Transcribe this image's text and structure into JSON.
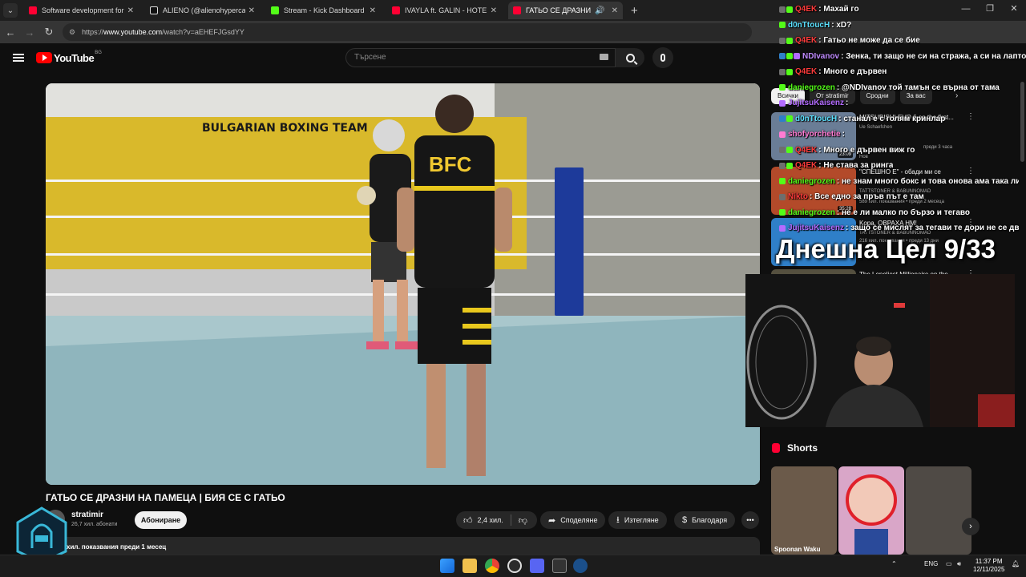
{
  "browser": {
    "tabs": [
      {
        "title": "Software development for the",
        "favicon_color": "#ff0033",
        "active": false
      },
      {
        "title": "ALIENO (@alienohypercars) | TikTok",
        "favicon_color": "#ffffff",
        "active": false
      },
      {
        "title": "Stream - Kick Dashboard",
        "favicon_color": "#53fc18",
        "active": false
      },
      {
        "title": "IVAYLA ft. GALIN - HOTEL | ИВА",
        "favicon_color": "#ff0033",
        "active": false
      },
      {
        "title": "ГАТЬО СЕ ДРАЗНИ НА ПАМ",
        "favicon_color": "#ff0033",
        "active": true
      }
    ],
    "url_prefix": "https://",
    "url_host": "www.youtube.com",
    "url_path": "/watch?v=aEHEFJGsdYY"
  },
  "youtube": {
    "logo_text": "YouTube",
    "region": "BG",
    "search_placeholder": "Търсене",
    "video_title": "ГАТЬО СЕ ДРАЗНИ НА ПАМЕЦА | БИЯ СЕ С ГАТЬО",
    "channel_name": "stratimir",
    "subscribers": "26,7 хил. абонати",
    "subscribe_label": "Абониране",
    "likes": "2,4 хил.",
    "share_label": "Споделяне",
    "download_label": "Изтегляне",
    "thanks_label": "Благодаря",
    "desc_meta": "хил. показвания  преди 1 месец",
    "wall_text": "BULGARIAN BOXING TEAM",
    "shirt_text": "BFC",
    "chips": [
      "Всички",
      "От stratimir",
      "Сродни",
      "За вас"
    ],
    "recommendations": [
      {
        "title": "MITSUBISHI EVO 6 on the first...",
        "channel": "Ue Schaefchen",
        "meta": "преди 3 часа",
        "tag": "Нов",
        "duration": "23:09",
        "thumb_color": "#6a7d96"
      },
      {
        "title": "\"СПЕШНО Е\" - обади ми се",
        "channel": "TATTSTONER & BABUNNOMAD",
        "meta": "589 хил. показвания • преди 2 месеца",
        "tag": "",
        "duration": "35:28",
        "thumb_color": "#b34a2a"
      },
      {
        "title": "Kopa, OBPAXA HM!",
        "channel": "TATTSTONER & BABUNNOMAD",
        "meta": "216 хил. показвания • преди 13 дни",
        "tag": "",
        "duration": "",
        "thumb_color": "#2f7fc8"
      },
      {
        "title": "The Loneliest Millionaire on the",
        "channel": "",
        "meta": "",
        "tag": "",
        "duration": "",
        "thumb_color": "#55503f"
      }
    ],
    "shorts_title": "Shorts",
    "shorts": [
      {
        "caption": "Spoonan Waku",
        "color": "#6b5a4a"
      },
      {
        "caption": "",
        "color": "#d9a6c8"
      },
      {
        "caption": "",
        "color": "#4f4a45"
      }
    ]
  },
  "overlay": {
    "goal_text": "Днешна Цел 9/33",
    "chat": [
      {
        "user": "Q4EK",
        "color": "#ff3b3b",
        "text": "Махай го"
      },
      {
        "user": "d0nTtoucH",
        "color": "#5ce1ff",
        "text": "xD?"
      },
      {
        "user": "Q4EK",
        "color": "#ff3b3b",
        "text": "Гатьо не може да се бие"
      },
      {
        "user": "NDIvanov",
        "color": "#c08bff",
        "text": "Зенка, ти защо не си на стража, а си на лаптопа"
      },
      {
        "user": "Q4EK",
        "color": "#ff3b3b",
        "text": "Много е дървен"
      },
      {
        "user": "daniegrozen",
        "color": "#53fc18",
        "text": "@NDIvanov той тамън се върна от тама"
      },
      {
        "user": "JujitsuKaisenz",
        "color": "#b36bff",
        "text": ""
      },
      {
        "user": "d0nTtoucH",
        "color": "#5ce1ff",
        "text": "станал е с голям кринлар"
      },
      {
        "user": "shofyorchetie",
        "color": "#ff7bd3",
        "text": ""
      },
      {
        "user": "Q4EK",
        "color": "#ff3b3b",
        "text": "Много е дървен виж го"
      },
      {
        "user": "Q4EK",
        "color": "#ff3b3b",
        "text": "Не става за ринга"
      },
      {
        "user": "daniegrozen",
        "color": "#53fc18",
        "text": "не знам много бокс и това онова ама така ли се се"
      },
      {
        "user": "Nikto",
        "color": "#ff3b3b",
        "text": "Все едно за пръв път е там"
      },
      {
        "user": "daniegrozen",
        "color": "#53fc18",
        "text": "не е ли малко по бързо и тегаво"
      },
      {
        "user": "JujitsuKaisenz",
        "color": "#b36bff",
        "text": "защо се мислят за тегави те дори не се движат"
      }
    ]
  },
  "taskbar": {
    "language": "ENG",
    "time": "11:37 PM",
    "date": "12/11/2025"
  }
}
